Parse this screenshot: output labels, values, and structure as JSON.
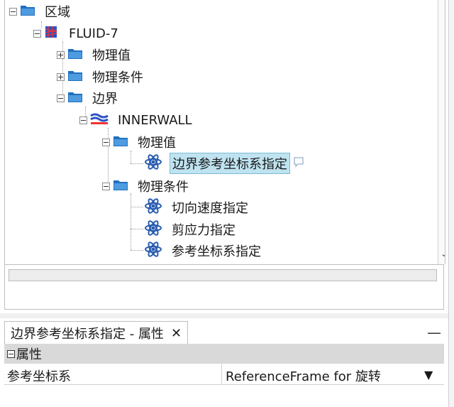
{
  "tree": {
    "nodes": [
      {
        "label": "区域",
        "icon": "folder-icon"
      },
      {
        "label": "FLUID-7",
        "icon": "region-mesh-icon"
      },
      {
        "label": "物理值",
        "icon": "folder-icon"
      },
      {
        "label": "物理条件",
        "icon": "folder-icon"
      },
      {
        "label": "边界",
        "icon": "folder-icon"
      },
      {
        "label": "INNERWALL",
        "icon": "boundary-wall-icon"
      },
      {
        "label": "物理值",
        "icon": "folder-icon"
      },
      {
        "label": "边界参考坐标系指定",
        "icon": "atom-value-icon"
      },
      {
        "label": "物理条件",
        "icon": "folder-icon"
      },
      {
        "label": "切向速度指定",
        "icon": "atom-value-icon"
      },
      {
        "label": "剪应力指定",
        "icon": "atom-value-icon"
      },
      {
        "label": "参考坐标系指定",
        "icon": "atom-value-icon"
      }
    ]
  },
  "properties": {
    "tab_title": "边界参考坐标系指定 - 属性",
    "close_glyph": "✕",
    "minimize_glyph": "—",
    "group_label": "属性",
    "rows": [
      {
        "name": "参考坐标系",
        "value": "ReferenceFrame for 旋转"
      }
    ]
  },
  "colors": {
    "selection": "#bfe3f0",
    "folder": "#1f6fc0",
    "atom": "#2a5db0"
  }
}
